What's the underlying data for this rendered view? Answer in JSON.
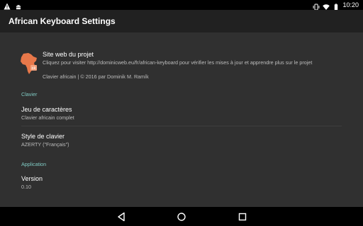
{
  "status_bar": {
    "time": "10:20",
    "left_icons": [
      "warning-icon",
      "android-debug-icon"
    ],
    "right_icons": [
      "vibrate-icon",
      "wifi-icon",
      "battery-icon"
    ]
  },
  "app_bar": {
    "title": "African Keyboard Settings"
  },
  "header": {
    "icon": "africa-keyboard-logo-icon",
    "title": "Site web du projet",
    "summary": "Cliquez pour visiter http://dominicweb.eu/fr/african-keyboard pour vérifier les mises à jour et apprendre plus sur le projet",
    "copyright": "Clavier africain | © 2016 par Dominik M. Ramík"
  },
  "clavier": {
    "category": "Clavier",
    "items": [
      {
        "title": "Jeu de caractères",
        "summary": "Clavier africain complet"
      },
      {
        "title": "Style de clavier",
        "summary": "AZERTY (\"Français\")"
      }
    ]
  },
  "application": {
    "category": "Application",
    "items": [
      {
        "title": "Version",
        "summary": "0.10"
      }
    ]
  },
  "nav_bar": {
    "buttons": [
      "back-icon",
      "home-icon",
      "recents-icon"
    ]
  },
  "colors": {
    "accent": "#80cbc4",
    "background": "#303030",
    "app_bar": "#212121",
    "logo": "#e8784a"
  }
}
